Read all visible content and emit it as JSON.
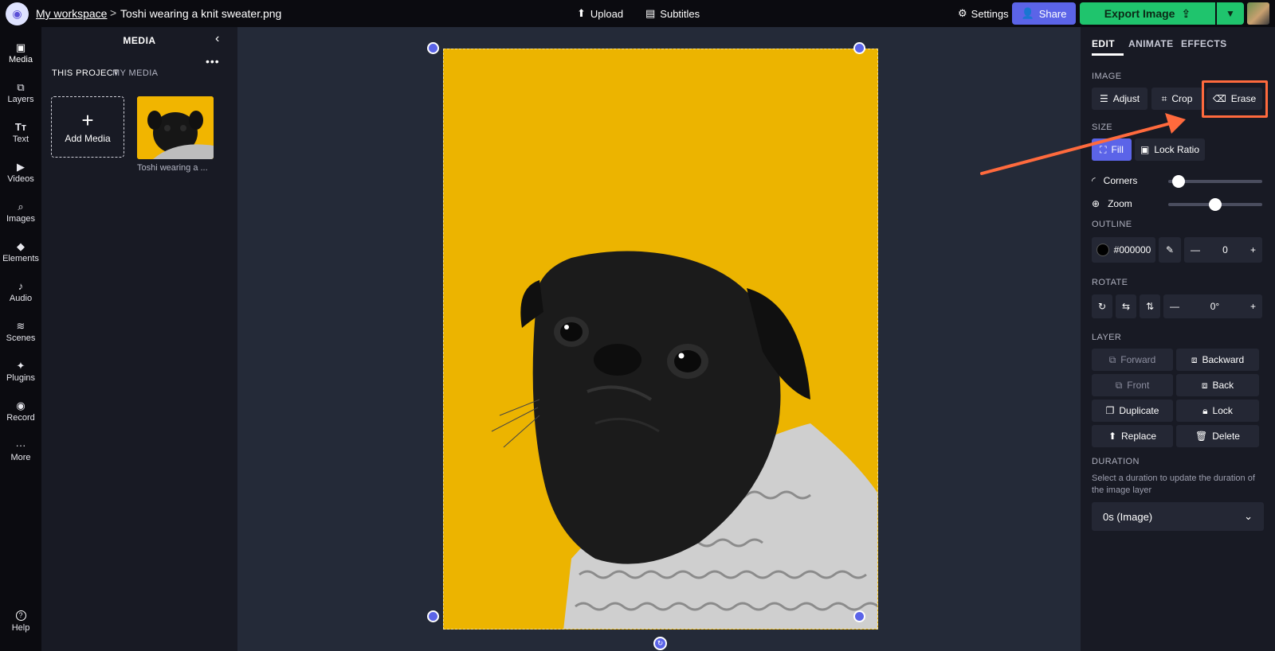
{
  "topbar": {
    "logo_glyph": "◉",
    "workspace_link": "My workspace",
    "separator": ">",
    "file_title": "Toshi wearing a knit sweater.png",
    "upload_label": "Upload",
    "subtitles_label": "Subtitles",
    "settings_label": "Settings",
    "share_label": "Share",
    "export_label": "Export Image"
  },
  "rail": {
    "items": [
      {
        "label": "Media",
        "icon": "▣"
      },
      {
        "label": "Layers",
        "icon": "⧉"
      },
      {
        "label": "Text",
        "icon": "Tт"
      },
      {
        "label": "Videos",
        "icon": "▶"
      },
      {
        "label": "Images",
        "icon": "⌕"
      },
      {
        "label": "Elements",
        "icon": "◆"
      },
      {
        "label": "Audio",
        "icon": "♪"
      },
      {
        "label": "Scenes",
        "icon": "≋"
      },
      {
        "label": "Plugins",
        "icon": "✦"
      },
      {
        "label": "Record",
        "icon": "◉"
      },
      {
        "label": "More",
        "icon": "···"
      }
    ],
    "help_label": "Help",
    "help_icon": "?"
  },
  "media": {
    "title": "MEDIA",
    "tab_project": "THIS PROJECT",
    "tab_my_media": "MY MEDIA",
    "add_media_label": "Add Media",
    "thumb_caption": "Toshi wearing a ..."
  },
  "panel": {
    "tabs": [
      "EDIT",
      "ANIMATE",
      "EFFECTS"
    ],
    "image_section": "IMAGE",
    "adjust_label": "Adjust",
    "crop_label": "Crop",
    "erase_label": "Erase",
    "size_section": "SIZE",
    "fill_label": "Fill",
    "lock_ratio_label": "Lock Ratio",
    "corners_label": "Corners",
    "zoom_label": "Zoom",
    "outline_section": "OUTLINE",
    "outline_color": "#000000",
    "outline_value": "0",
    "rotate_section": "ROTATE",
    "rotate_value": "0°",
    "layer_section": "LAYER",
    "forward_label": "Forward",
    "backward_label": "Backward",
    "front_label": "Front",
    "back_label": "Back",
    "duplicate_label": "Duplicate",
    "lock_label": "Lock",
    "replace_label": "Replace",
    "delete_label": "Delete",
    "duration_section": "DURATION",
    "duration_hint": "Select a duration to update the duration of the image layer",
    "duration_value": "0s (Image)"
  },
  "sliders": {
    "corners_fraction": 0.05,
    "zoom_fraction": 0.5
  },
  "colors": {
    "accent": "#5b64e8",
    "export": "#1fc46d",
    "annotation": "#ff6a3d",
    "image_bg": "#ecb400"
  }
}
